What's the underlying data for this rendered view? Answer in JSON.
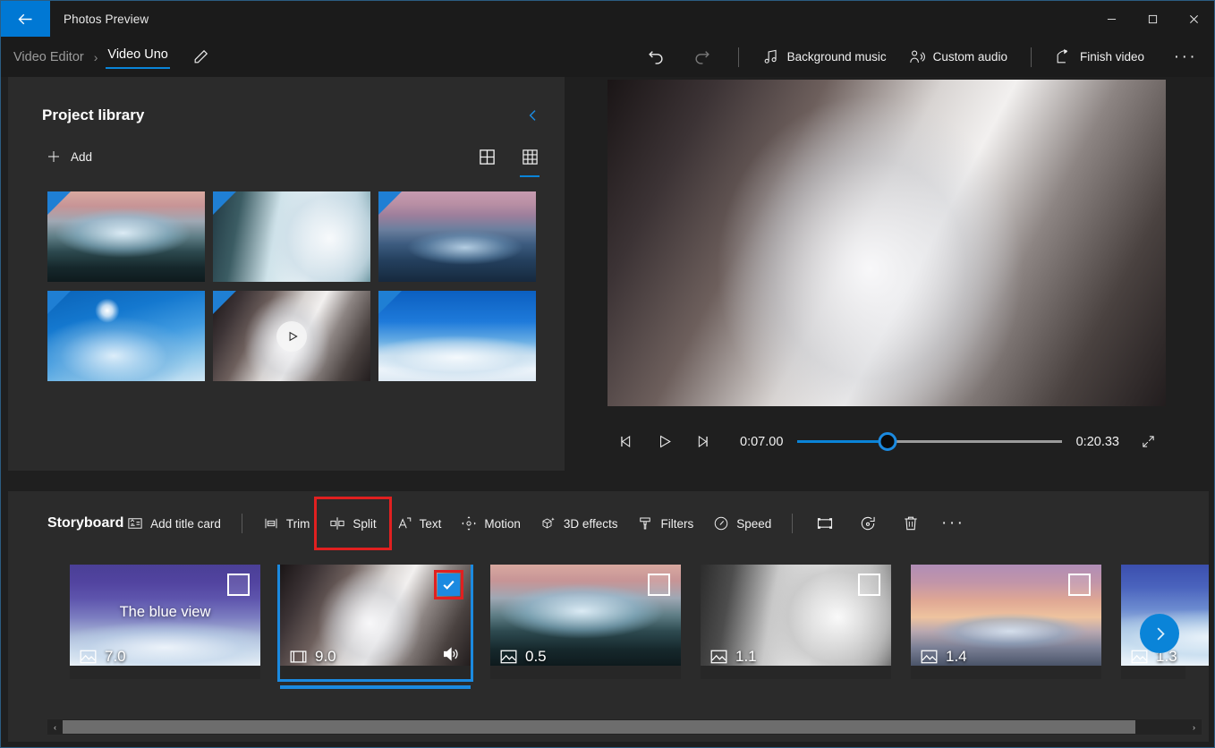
{
  "window": {
    "app_title": "Photos Preview",
    "back_icon": "arrow-left-icon",
    "minimize_label": "—",
    "maximize_label": "□",
    "close_label": "✕"
  },
  "breadcrumb": {
    "root": "Video Editor",
    "separator": "›",
    "current": "Video Uno",
    "rename_icon": "pencil-icon"
  },
  "top_toolbar": {
    "undo_icon": "undo-icon",
    "redo_icon": "redo-icon",
    "items": [
      {
        "label": "Background music",
        "icon": "music-note-icon"
      },
      {
        "label": "Custom audio",
        "icon": "person-audio-icon"
      },
      {
        "label": "Finish video",
        "icon": "share-export-icon"
      }
    ],
    "more_label": "···"
  },
  "library": {
    "title": "Project library",
    "collapse_icon": "chevron-left-icon",
    "add_label": "Add",
    "add_icon": "plus-icon",
    "view_large_icon": "grid-large-icon",
    "view_small_icon": "grid-small-icon",
    "active_view": "grid-small-icon",
    "thumbnails": [
      {
        "name": "iceberg-sunset-reflection",
        "style": "ph-ice-sunset",
        "is_video": false,
        "flagged": true
      },
      {
        "name": "iceberg-wall-texture",
        "style": "ph-ice-texture",
        "is_video": false,
        "flagged": true
      },
      {
        "name": "iceberg-dusk-horizon",
        "style": "ph-berg-dusk",
        "is_video": false,
        "flagged": true
      },
      {
        "name": "blue-ice-sunburst",
        "style": "ph-blue-sun",
        "is_video": false,
        "flagged": true
      },
      {
        "name": "waterfall-rocks-video",
        "style": "ph-waterfall",
        "is_video": true,
        "flagged": true
      },
      {
        "name": "snow-mountain-blue-sky",
        "style": "ph-mountain",
        "is_video": false,
        "flagged": true
      }
    ]
  },
  "player": {
    "preview_name": "waterfall-rocks-preview",
    "preview_style": "ph-waterfall",
    "prev_frame_icon": "previous-frame-icon",
    "play_icon": "play-icon",
    "next_frame_icon": "next-frame-icon",
    "current_time": "0:07.00",
    "total_time": "0:20.33",
    "progress_percent": 34,
    "fullscreen_icon": "expand-icon"
  },
  "storyboard": {
    "title": "Storyboard",
    "tools": [
      {
        "label": "Add title card",
        "icon": "title-card-icon",
        "highlighted": false
      },
      {
        "label": "Trim",
        "icon": "trim-icon",
        "highlighted": false
      },
      {
        "label": "Split",
        "icon": "split-icon",
        "highlighted": true
      },
      {
        "label": "Text",
        "icon": "text-icon",
        "highlighted": false
      },
      {
        "label": "Motion",
        "icon": "motion-icon",
        "highlighted": false
      },
      {
        "label": "3D effects",
        "icon": "cube-sparkle-icon",
        "highlighted": false
      },
      {
        "label": "Filters",
        "icon": "filters-icon",
        "highlighted": false
      },
      {
        "label": "Speed",
        "icon": "speed-gauge-icon",
        "highlighted": false
      }
    ],
    "icon_buttons": [
      {
        "name": "resize-frame-icon"
      },
      {
        "name": "rotate-icon"
      },
      {
        "name": "delete-trash-icon"
      }
    ],
    "more_label": "···",
    "clips": [
      {
        "name": "clip-the-blue-view",
        "caption": "The blue view",
        "duration": "7.0",
        "type_icon": "photo-icon",
        "style": "ph-blue-title",
        "selected": false,
        "checked": false,
        "has_audio": false
      },
      {
        "name": "clip-waterfall",
        "caption": "",
        "duration": "9.0",
        "type_icon": "video-icon",
        "style": "ph-waterfall",
        "selected": true,
        "checked": true,
        "has_audio": true
      },
      {
        "name": "clip-iceberg-sunset",
        "caption": "",
        "duration": "0.5",
        "type_icon": "photo-icon",
        "style": "ph-ice-sunset",
        "selected": false,
        "checked": false,
        "has_audio": false
      },
      {
        "name": "clip-ice-gray",
        "caption": "",
        "duration": "1.1",
        "type_icon": "photo-icon",
        "style": "ph-grayberg",
        "selected": false,
        "checked": false,
        "has_audio": false
      },
      {
        "name": "clip-berg-pink",
        "caption": "",
        "duration": "1.4",
        "type_icon": "photo-icon",
        "style": "ph-berg-pink",
        "selected": false,
        "checked": false,
        "has_audio": false
      },
      {
        "name": "clip-partial",
        "caption": "",
        "duration": "1.3",
        "type_icon": "photo-icon",
        "style": "ph-partial",
        "selected": false,
        "checked": false,
        "has_audio": false
      }
    ],
    "next_arrow_icon": "chevron-right-icon",
    "scroll_left_label": "‹",
    "scroll_right_label": "›"
  },
  "colors": {
    "accent": "#0a84d8",
    "highlight_box": "#e02020",
    "panel": "#2b2b2b",
    "chrome": "#1b1b1b"
  }
}
